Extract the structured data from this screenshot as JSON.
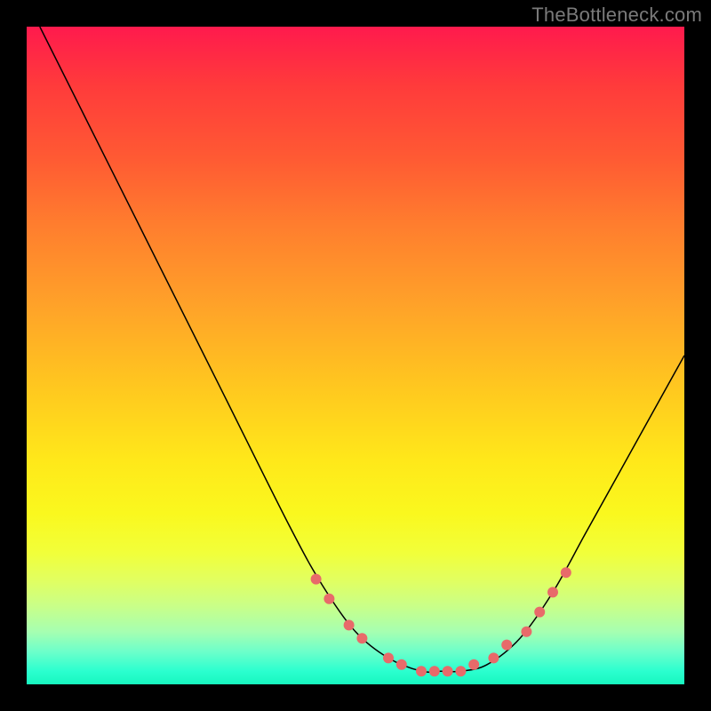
{
  "watermark": "TheBottleneck.com",
  "chart_data": {
    "type": "line",
    "title": "",
    "xlabel": "",
    "ylabel": "",
    "xlim": [
      0,
      100
    ],
    "ylim": [
      0,
      100
    ],
    "grid": false,
    "legend": false,
    "series": [
      {
        "name": "curve",
        "x": [
          2,
          10,
          20,
          30,
          40,
          45,
          50,
          55,
          60,
          63,
          66,
          70,
          75,
          80,
          85,
          90,
          100
        ],
        "y": [
          100,
          84,
          64,
          44,
          24,
          15,
          8,
          4,
          2,
          2,
          2,
          3,
          7,
          14,
          23,
          32,
          50
        ],
        "stroke": "#000000",
        "stroke_width": 1.5
      }
    ],
    "markers": {
      "name": "dots",
      "color": "#e86a6a",
      "radius": 6,
      "points": [
        {
          "x": 44,
          "y": 16
        },
        {
          "x": 46,
          "y": 13
        },
        {
          "x": 49,
          "y": 9
        },
        {
          "x": 51,
          "y": 7
        },
        {
          "x": 55,
          "y": 4
        },
        {
          "x": 57,
          "y": 3
        },
        {
          "x": 60,
          "y": 2
        },
        {
          "x": 62,
          "y": 2
        },
        {
          "x": 64,
          "y": 2
        },
        {
          "x": 66,
          "y": 2
        },
        {
          "x": 68,
          "y": 3
        },
        {
          "x": 71,
          "y": 4
        },
        {
          "x": 73,
          "y": 6
        },
        {
          "x": 76,
          "y": 8
        },
        {
          "x": 78,
          "y": 11
        },
        {
          "x": 80,
          "y": 14
        },
        {
          "x": 82,
          "y": 17
        }
      ]
    }
  }
}
